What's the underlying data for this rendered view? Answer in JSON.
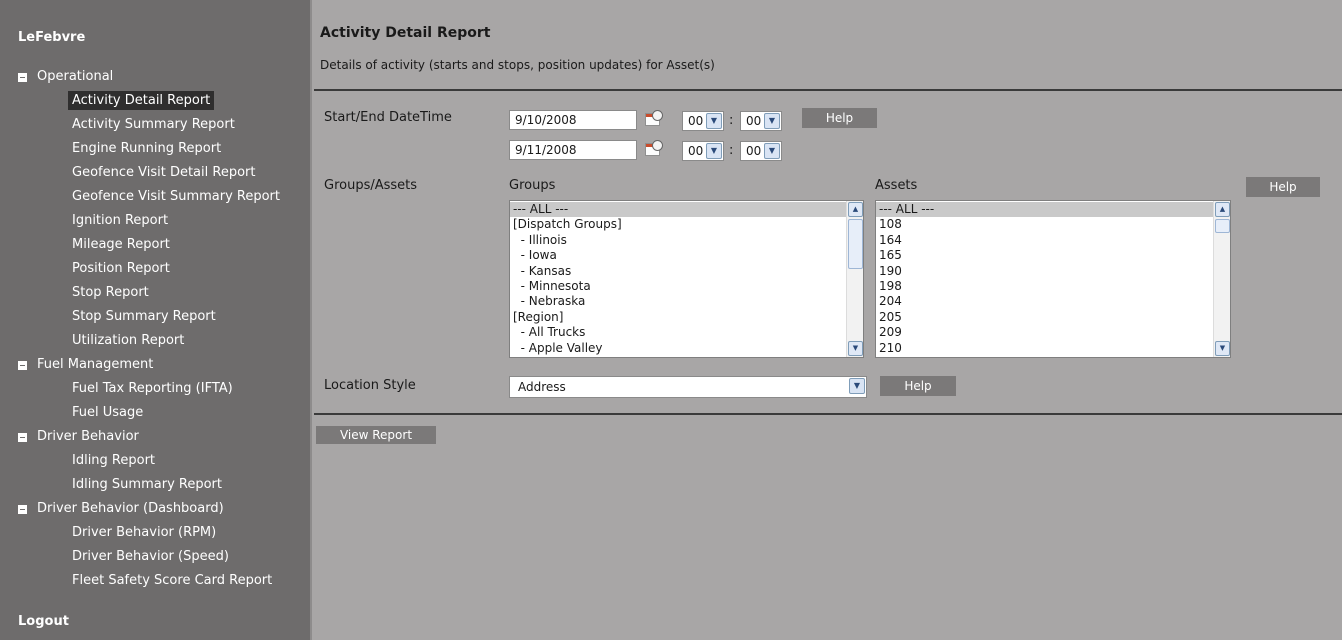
{
  "sidebar": {
    "brand": "LeFebvre",
    "groups": [
      {
        "label": "Operational",
        "items": [
          "Activity Detail Report",
          "Activity Summary Report",
          "Engine Running Report",
          "Geofence Visit Detail Report",
          "Geofence Visit Summary Report",
          "Ignition Report",
          "Mileage Report",
          "Position Report",
          "Stop Report",
          "Stop Summary Report",
          "Utilization Report"
        ]
      },
      {
        "label": "Fuel Management",
        "items": [
          "Fuel Tax Reporting (IFTA)",
          "Fuel Usage"
        ]
      },
      {
        "label": "Driver Behavior",
        "items": [
          "Idling Report",
          "Idling Summary Report"
        ]
      },
      {
        "label": "Driver Behavior (Dashboard)",
        "items": [
          "Driver Behavior (RPM)",
          "Driver Behavior (Speed)",
          "Fleet Safety Score Card Report"
        ]
      }
    ],
    "active_item": "Activity Detail Report",
    "logout": "Logout"
  },
  "main": {
    "title": "Activity Detail Report",
    "subtitle": "Details of activity (starts and stops, position updates) for Asset(s)",
    "datetime": {
      "label": "Start/End DateTime",
      "start_date": "9/10/2008",
      "start_hour": "00",
      "start_minute": "00",
      "end_date": "9/11/2008",
      "end_hour": "00",
      "end_minute": "00",
      "separator": ":",
      "help": "Help"
    },
    "groups_assets": {
      "label": "Groups/Assets",
      "groups_header": "Groups",
      "assets_header": "Assets",
      "help": "Help",
      "groups": [
        "--- ALL ---",
        "[Dispatch Groups]",
        "  - Illinois",
        "  - Iowa",
        "  - Kansas",
        "  - Minnesota",
        "  - Nebraska",
        "[Region]",
        "  - All Trucks",
        "  - Apple Valley"
      ],
      "assets": [
        "--- ALL ---",
        "108",
        "164",
        "165",
        "190",
        "198",
        "204",
        "205",
        "209",
        "210"
      ]
    },
    "location": {
      "label": "Location Style",
      "value": "Address",
      "help": "Help"
    },
    "view_report": "View Report"
  }
}
